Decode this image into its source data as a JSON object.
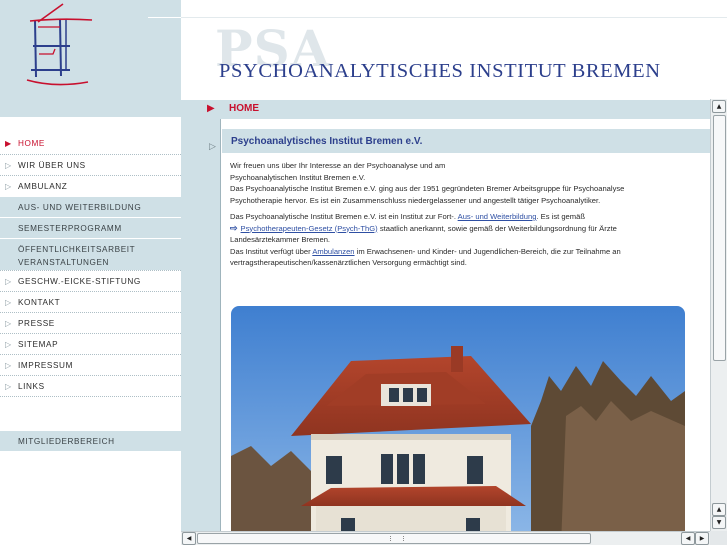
{
  "header": {
    "watermark": "PSA",
    "title": "PSYCHOANALYTISCHES INSTITUT BREMEN"
  },
  "breadcrumb": {
    "current": "HOME"
  },
  "nav": {
    "items": [
      {
        "label": "HOME",
        "active": true
      },
      {
        "label": "WIR ÜBER UNS"
      },
      {
        "label": "AMBULANZ"
      },
      {
        "label": "AUS- UND WEITERBILDUNG",
        "sub": true
      },
      {
        "label": "SEMESTERPROGRAMM",
        "sub": true
      },
      {
        "label": "ÖFFENTLICHKEITSARBEIT",
        "sub": true
      },
      {
        "label": "VERANSTALTUNGEN",
        "sub": true
      },
      {
        "label": "GESCHW.-EICKE-STIFTUNG"
      },
      {
        "label": "KONTAKT"
      },
      {
        "label": "PRESSE"
      },
      {
        "label": "SITEMAP"
      },
      {
        "label": "IMPRESSUM"
      },
      {
        "label": "LINKS"
      }
    ],
    "member": "MITGLIEDERBEREICH"
  },
  "content": {
    "heading": "Psychoanalytisches Institut Bremen e.V.",
    "p1_line1": "Wir freuen uns über Ihr Interesse an der Psychoanalyse und am",
    "p1_line2": "Psychoanalytischen Institut Bremen e.V.",
    "p1_line3": "Das Psychoanalytische Institut Bremen e.V. ging aus der 1951 gegründeten Bremer Arbeitsgruppe für Psychoanalyse",
    "p1_line4": "Psychotherapie hervor. Es ist ein Zusammenschluss niedergelassener und angestellt tätiger Psychoanalytiker.",
    "p2_line1_a": "Das Psychoanalytische Institut Bremen e.V. ist ein Institut zur Fort-. ",
    "p2_link1": "Aus- und Weiterbildung",
    "p2_line1_b": ". Es ist gemäß",
    "p2_link2": "Psychotherapeuten-Gesetz (Psych-ThG)",
    "p2_line2_b": " staatlich anerkannt, sowie gemäß der Weiterbildungsordnung für Ärzte",
    "p2_line3": "Landesärztekammer Bremen.",
    "p3_line1_a": "Das Institut verfügt über ",
    "p3_link": "Ambulanzen",
    "p3_line1_b": " im Erwachsenen- und Kinder- und Jugendlichen-Bereich, die zur Teilnahme an",
    "p3_line2": "vertragstherapeutischen/kassenärztlichen Versorgung ermächtigt sind."
  },
  "icons": {
    "nav_bullet": "triangle-outline-icon",
    "active_bullet": "triangle-solid-icon",
    "external_link": "external-link-icon",
    "scroll_up": "arrow-up-icon",
    "scroll_down": "arrow-down-icon",
    "scroll_left": "arrow-left-icon",
    "scroll_right": "arrow-right-icon"
  },
  "colors": {
    "accent_red": "#c8102e",
    "brand_blue": "#2c3f8c",
    "panel_blue": "#cfe0e6",
    "link_blue": "#2e4fa3"
  }
}
